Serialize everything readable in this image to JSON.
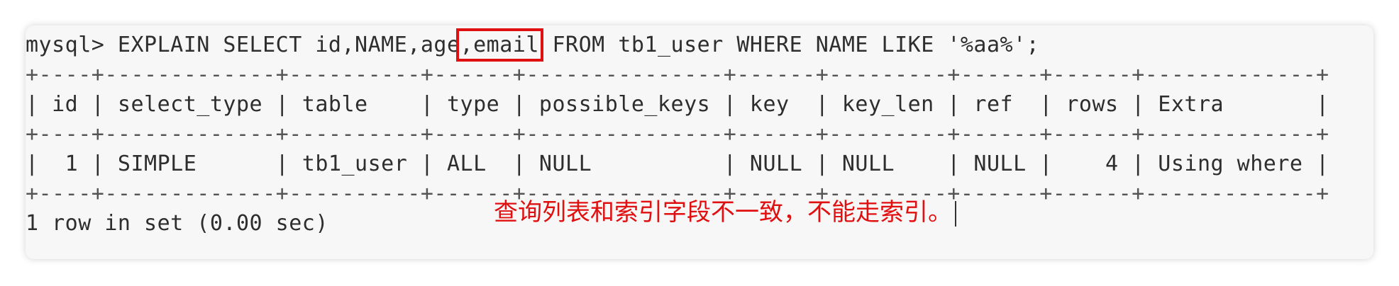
{
  "terminal": {
    "command_pre": "mysql> EXPLAIN SELECT id,NAME,age",
    "command_highlight": ",email",
    "command_post": " FROM tb1_user WHERE NAME LIKE '%aa%';",
    "border_line": "+----+-------------+----------+------+---------------+------+---------+------+------+-------------+",
    "header_line": "| id | select_type | table    | type | possible_keys | key  | key_len | ref  | rows | Extra       |",
    "row_line": "|  1 | SIMPLE      | tb1_user | ALL  | NULL          | NULL | NULL    | NULL |    4 | Using where |",
    "footer": "1 row in set (0.00 sec)"
  },
  "result_table": {
    "columns": [
      "id",
      "select_type",
      "table",
      "type",
      "possible_keys",
      "key",
      "key_len",
      "ref",
      "rows",
      "Extra"
    ],
    "rows": [
      [
        "1",
        "SIMPLE",
        "tb1_user",
        "ALL",
        "NULL",
        "NULL",
        "NULL",
        "NULL",
        "4",
        "Using where"
      ]
    ]
  },
  "annotation": {
    "text": "查询列表和索引字段不一致，不能走索引。",
    "color": "#e01010"
  },
  "colors": {
    "highlight_box": "#e01010",
    "terminal_bg": "#f7f7f7",
    "text": "#2e2e2e"
  }
}
